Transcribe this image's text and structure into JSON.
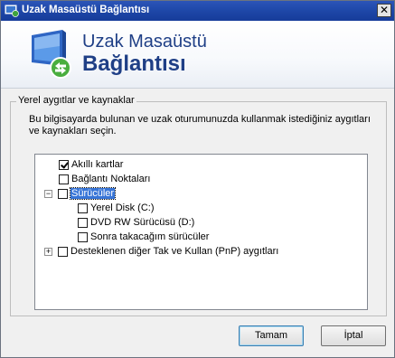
{
  "window": {
    "title": "Uzak Masaüstü Bağlantısı",
    "close_glyph": "✕"
  },
  "banner": {
    "line1": "Uzak Masaüstü",
    "line2": "Bağlantısı"
  },
  "group": {
    "label": "Yerel aygıtlar ve kaynaklar",
    "description": "Bu bilgisayarda bulunan ve uzak oturumunuzda kullanmak istediğiniz aygıtları ve kaynakları seçin."
  },
  "tree": {
    "items": [
      {
        "label": "Akıllı kartlar",
        "checked": true
      },
      {
        "label": "Bağlantı Noktaları",
        "checked": false
      },
      {
        "label": "Sürücüler",
        "checked": false,
        "expanded": true,
        "selected": true
      },
      {
        "label": "Yerel Disk (C:)",
        "checked": false
      },
      {
        "label": "DVD RW Sürücüsü (D:)",
        "checked": false
      },
      {
        "label": "Sonra takacağım sürücüler",
        "checked": false
      },
      {
        "label": "Desteklenen diğer Tak ve Kullan (PnP) aygıtları",
        "checked": false,
        "expanded": false
      }
    ],
    "expand_minus": "−",
    "expand_plus": "+"
  },
  "buttons": {
    "ok": "Tamam",
    "cancel": "İptal"
  },
  "colors": {
    "title_bar": "#1e47a8",
    "banner_text": "#1f3f86",
    "selection": "#3875d7"
  },
  "icons": {
    "title": "remote-desktop-icon",
    "banner": "remote-desktop-logo"
  }
}
